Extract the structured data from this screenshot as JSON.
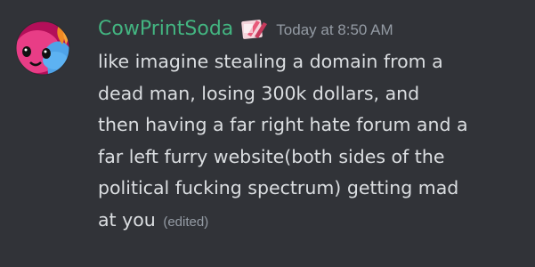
{
  "message": {
    "author": {
      "name": "CowPrintSoda",
      "color": "#43b581",
      "avatar_icon": "avatar-icon",
      "role_icon": "role-badge-icon"
    },
    "timestamp": "Today at 8:50 AM",
    "lines": [
      "like imagine stealing a domain from a",
      "dead man, losing 300k dollars, and",
      "then having a far right hate forum and a",
      "far left furry website(both sides of the",
      "political fucking spectrum) getting mad",
      "at you"
    ],
    "edited_label": "(edited)"
  },
  "colors": {
    "background": "#313338",
    "text": "#dbdee1",
    "muted": "#949ba4"
  }
}
